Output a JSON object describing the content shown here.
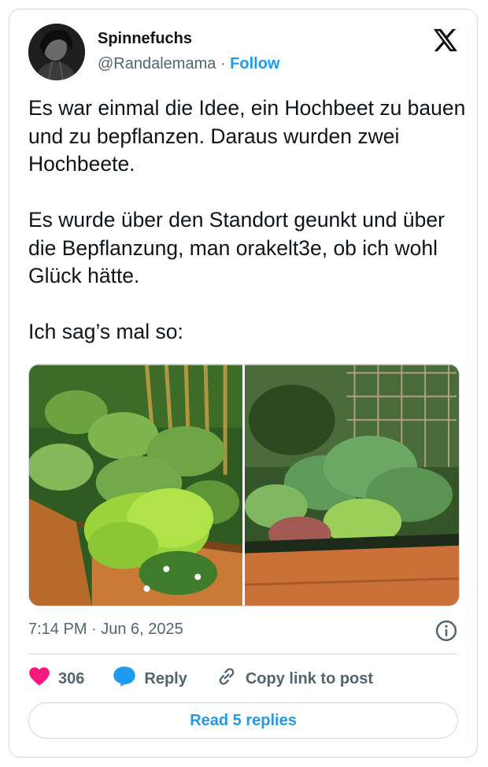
{
  "author": {
    "display_name": "Spinnefuchs",
    "handle": "@Randalemama",
    "separator": "·",
    "follow_label": "Follow"
  },
  "tweet": {
    "text": "Es war einmal die Idee, ein Hochbeet zu bauen und zu bepflanzen. Daraus wurden zwei Hochbeete.\n\nEs wurde über den Standort geunkt und über die Bepflanzung, man orakelt3e, ob ich wohl Glück hätte.\n\nIch sag’s mal so:",
    "timestamp": "7:14 PM · Jun 6, 2025"
  },
  "actions": {
    "like_count": "306",
    "reply_label": "Reply",
    "copy_label": "Copy link to post"
  },
  "footer": {
    "read_replies_label": "Read 5 replies"
  },
  "colors": {
    "accent": "#1d9bf0",
    "like": "#f91880",
    "muted": "#536471",
    "text": "#0f1419",
    "border": "#cfd9de"
  },
  "icons": [
    "x-logo-icon",
    "info-icon",
    "heart-icon",
    "reply-bubble-icon",
    "link-icon"
  ]
}
